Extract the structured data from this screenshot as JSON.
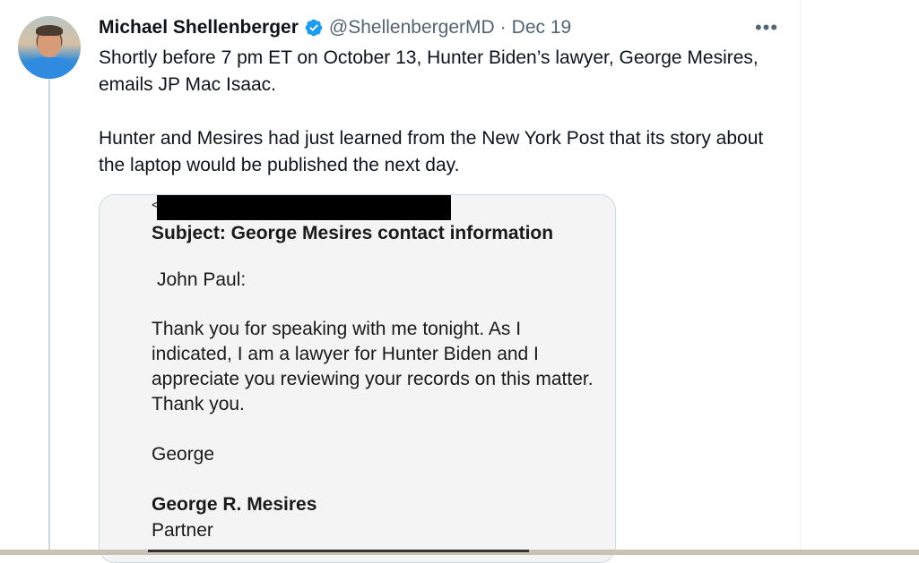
{
  "tweet": {
    "author_name": "Michael Shellenberger",
    "handle": "@ShellenbergerMD",
    "separator": "·",
    "date": "Dec 19",
    "more_label": "•••",
    "paragraph_1": "Shortly before 7 pm ET on October 13, Hunter Biden’s lawyer, George Mesires, emails JP Mac Isaac.",
    "paragraph_2": "Hunter and Mesires had just learned from the New York Post that its story about the laptop would be published the next day."
  },
  "media": {
    "redaction_prefix": "<",
    "subject": "Subject: George Mesires contact information",
    "greeting": "John Paul:",
    "body": "Thank you for speaking with me tonight. As I indicated, I am a lawyer for Hunter Biden and I appreciate you reviewing your records on this matter. Thank you.",
    "signoff": "George",
    "signature_name": "George R. Mesires",
    "signature_title": "Partner"
  },
  "colors": {
    "verified_badge": "#1d9bf0",
    "secondary_text": "#536471",
    "border": "#cfd9de"
  }
}
